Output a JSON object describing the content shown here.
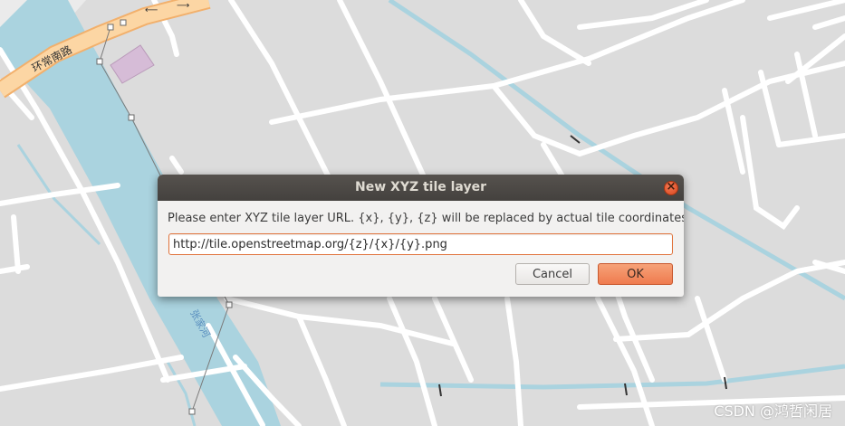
{
  "map": {
    "road_label_1": "环常南路",
    "water_label": "张家河"
  },
  "dialog": {
    "title": "New XYZ tile layer",
    "prompt": "Please enter XYZ tile layer URL. {x}, {y}, {z} will be replaced by actual tile coordinates.",
    "url_value": "http://tile.openstreetmap.org/{z}/{x}/{y}.png",
    "cancel_label": "Cancel",
    "ok_label": "OK",
    "close_icon": "close-icon"
  },
  "colors": {
    "map_background": "#dcdcdc",
    "road": "#ffffff",
    "primary_road": "#fcd6a4",
    "water": "#aad3df",
    "building": "#d6bcd7",
    "titlebar": "#4b4844",
    "accent": "#ef7b4f"
  },
  "watermark": "CSDN @鸿哲闲居"
}
